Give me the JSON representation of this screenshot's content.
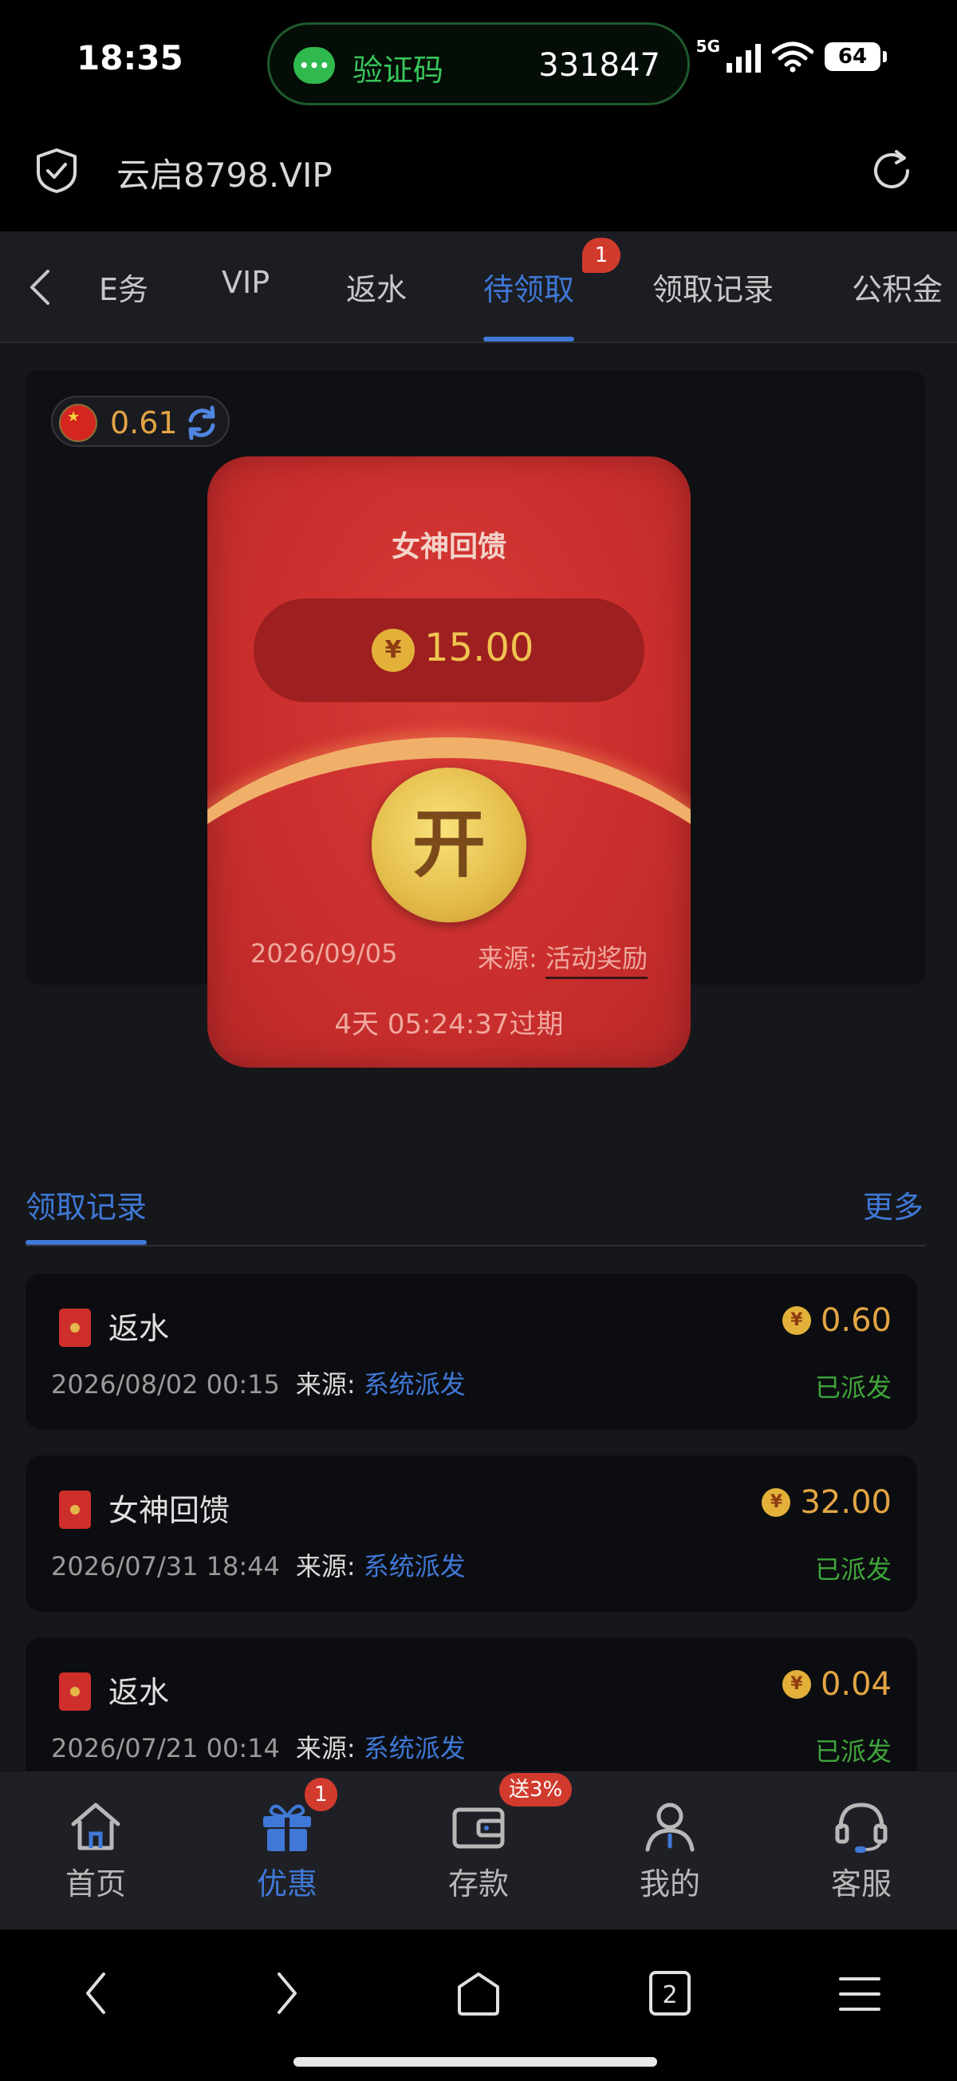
{
  "status_bar": {
    "time": "18:35",
    "sms_label": "验证码",
    "sms_code": "331847",
    "network": "5G",
    "battery": "64"
  },
  "url_bar": {
    "url": "云启8798.VIP"
  },
  "tabs": {
    "items": [
      "E务",
      "VIP",
      "返水",
      "待领取",
      "领取记录",
      "公积金"
    ],
    "active_index": 3,
    "badge": "1"
  },
  "balance": {
    "value": "0.61"
  },
  "red_packet": {
    "title": "女神回馈",
    "currency_symbol": "¥",
    "amount": "15.00",
    "open_label": "开",
    "date": "2026/09/05",
    "source_label": "来源:",
    "source_value": "活动奖励",
    "expire_text": "4天 05:24:37过期"
  },
  "records": {
    "title": "领取记录",
    "more_label": "更多",
    "source_label": "来源:",
    "items": [
      {
        "title": "返水",
        "datetime": "2026/08/02 00:15",
        "source": "系统派发",
        "amount": "0.60",
        "status": "已派发"
      },
      {
        "title": "女神回馈",
        "datetime": "2026/07/31 18:44",
        "source": "系统派发",
        "amount": "32.00",
        "status": "已派发"
      },
      {
        "title": "返水",
        "datetime": "2026/07/21 00:14",
        "source": "系统派发",
        "amount": "0.04",
        "status": "已派发"
      }
    ]
  },
  "bottom_nav": {
    "items": [
      {
        "label": "首页",
        "icon": "home-icon"
      },
      {
        "label": "优惠",
        "icon": "gift-icon",
        "badge": "1"
      },
      {
        "label": "存款",
        "icon": "wallet-icon",
        "badge": "送3%"
      },
      {
        "label": "我的",
        "icon": "user-icon"
      },
      {
        "label": "客服",
        "icon": "headset-icon"
      }
    ],
    "active_index": 1
  },
  "system_nav": {
    "tabs_count": "2"
  },
  "colors": {
    "accent": "#3f78d6",
    "gold": "#e3a544",
    "red_packet": "#c92e2d",
    "success": "#3fa63a",
    "badge": "#d13b2e"
  }
}
